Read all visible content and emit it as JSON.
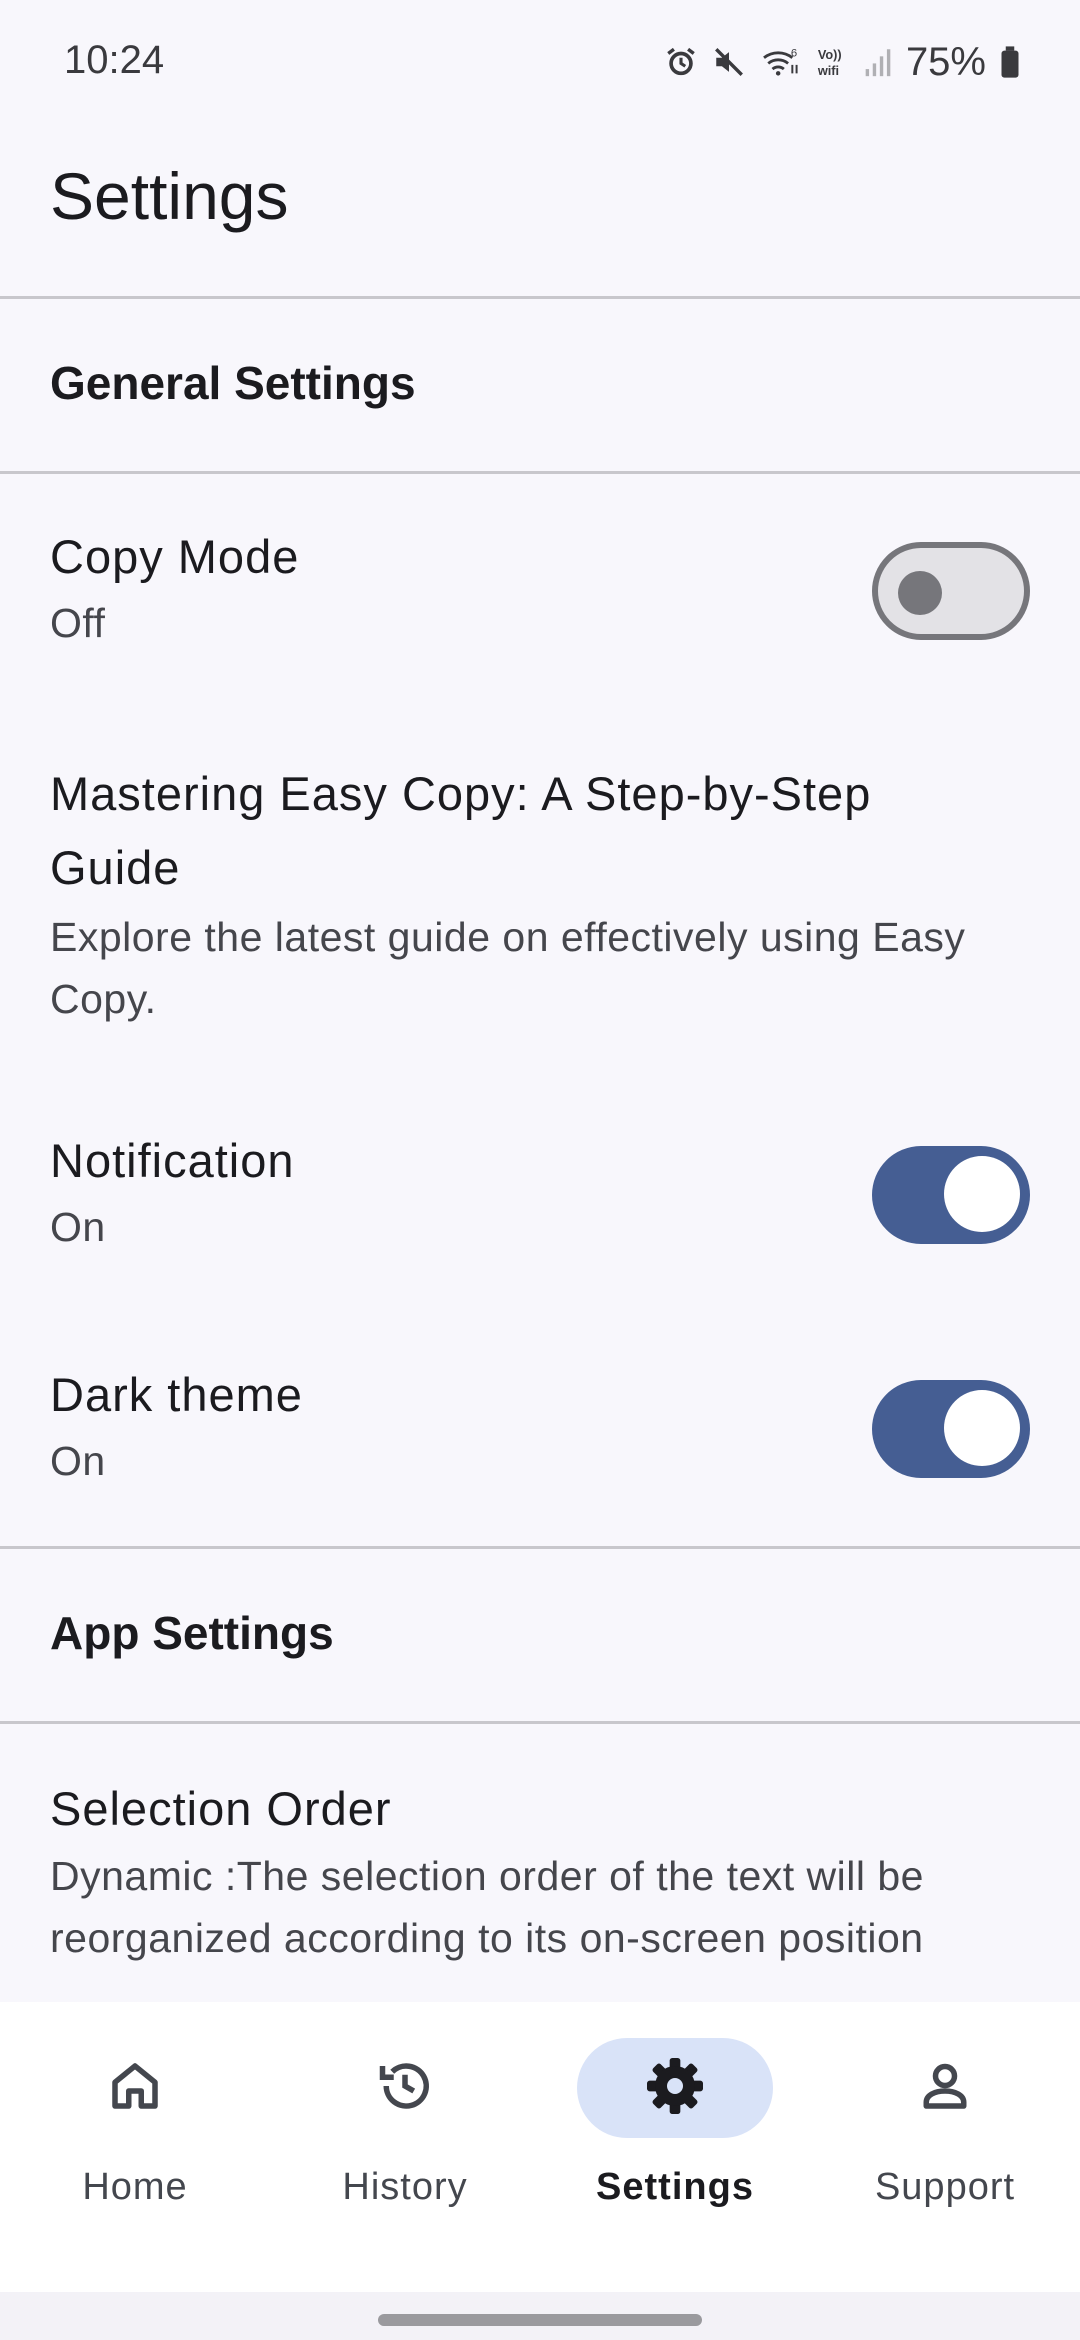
{
  "status_bar": {
    "time": "10:24",
    "battery": "75%",
    "icons": [
      "alarm-icon",
      "mute-icon",
      "wifi-icon",
      "volte-wifi-icon",
      "signal-icon",
      "battery-icon"
    ]
  },
  "header": {
    "title": "Settings"
  },
  "general": {
    "header": "General Settings",
    "copy_mode": {
      "title": "Copy Mode",
      "value": "Off",
      "enabled": false
    },
    "guide": {
      "title": "Mastering Easy Copy: A Step-by-Step Guide",
      "desc": "Explore the latest guide on effectively using Easy Copy."
    },
    "notification": {
      "title": "Notification",
      "value": "On",
      "enabled": true
    },
    "dark_theme": {
      "title": "Dark theme",
      "value": "On",
      "enabled": true
    }
  },
  "app": {
    "header": "App Settings",
    "selection_order": {
      "title": "Selection Order",
      "desc": "Dynamic :The selection order of the text will be reorganized according to its on-screen position"
    }
  },
  "nav": {
    "items": [
      {
        "label": "Home",
        "icon": "home-icon",
        "active": false
      },
      {
        "label": "History",
        "icon": "history-icon",
        "active": false
      },
      {
        "label": "Settings",
        "icon": "settings-icon",
        "active": true
      },
      {
        "label": "Support",
        "icon": "person-icon",
        "active": false
      }
    ]
  },
  "colors": {
    "background": "#f8f7fc",
    "accent": "#455e93",
    "active_nav_pill": "#d9e3f8",
    "divider": "#c8c7cc"
  }
}
